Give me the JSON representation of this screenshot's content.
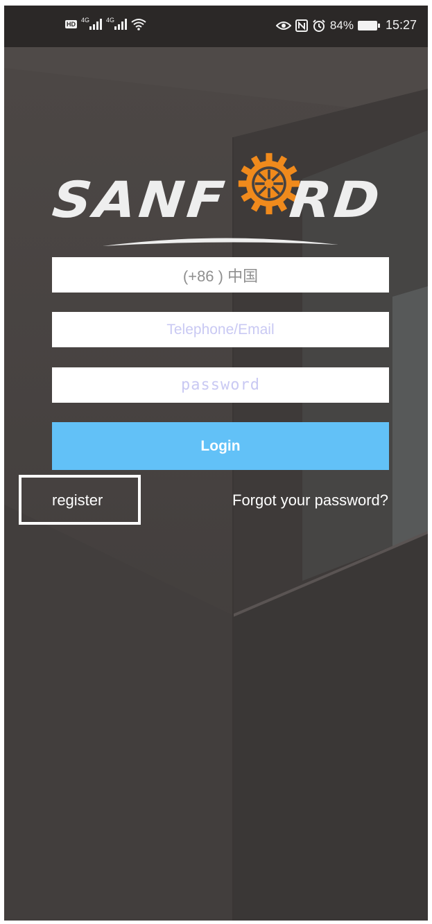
{
  "status_bar": {
    "left_icons": [
      "hd-icon",
      "signal-4g-icon",
      "signal-4g-icon",
      "wifi-icon"
    ],
    "hd_label": "HD",
    "network_label_1": "4G",
    "network_label_2": "4G",
    "right_icons": [
      "eye-icon",
      "nfc-icon",
      "alarm-icon",
      "battery-icon"
    ],
    "battery_percent": "84%",
    "time": "15:27"
  },
  "logo": {
    "text_left": "SANF",
    "text_right": "RD",
    "gear_color": "#f08a1c"
  },
  "form": {
    "country_code": "(+86 ) 中国",
    "account_placeholder": "Telephone/Email",
    "password_placeholder": "password",
    "login_label": "Login"
  },
  "links": {
    "register_label": "register",
    "forgot_label": "Forgot your password?"
  },
  "colors": {
    "login_button": "#62c1f7",
    "background": "#464241",
    "status_bar": "#2b2827"
  }
}
